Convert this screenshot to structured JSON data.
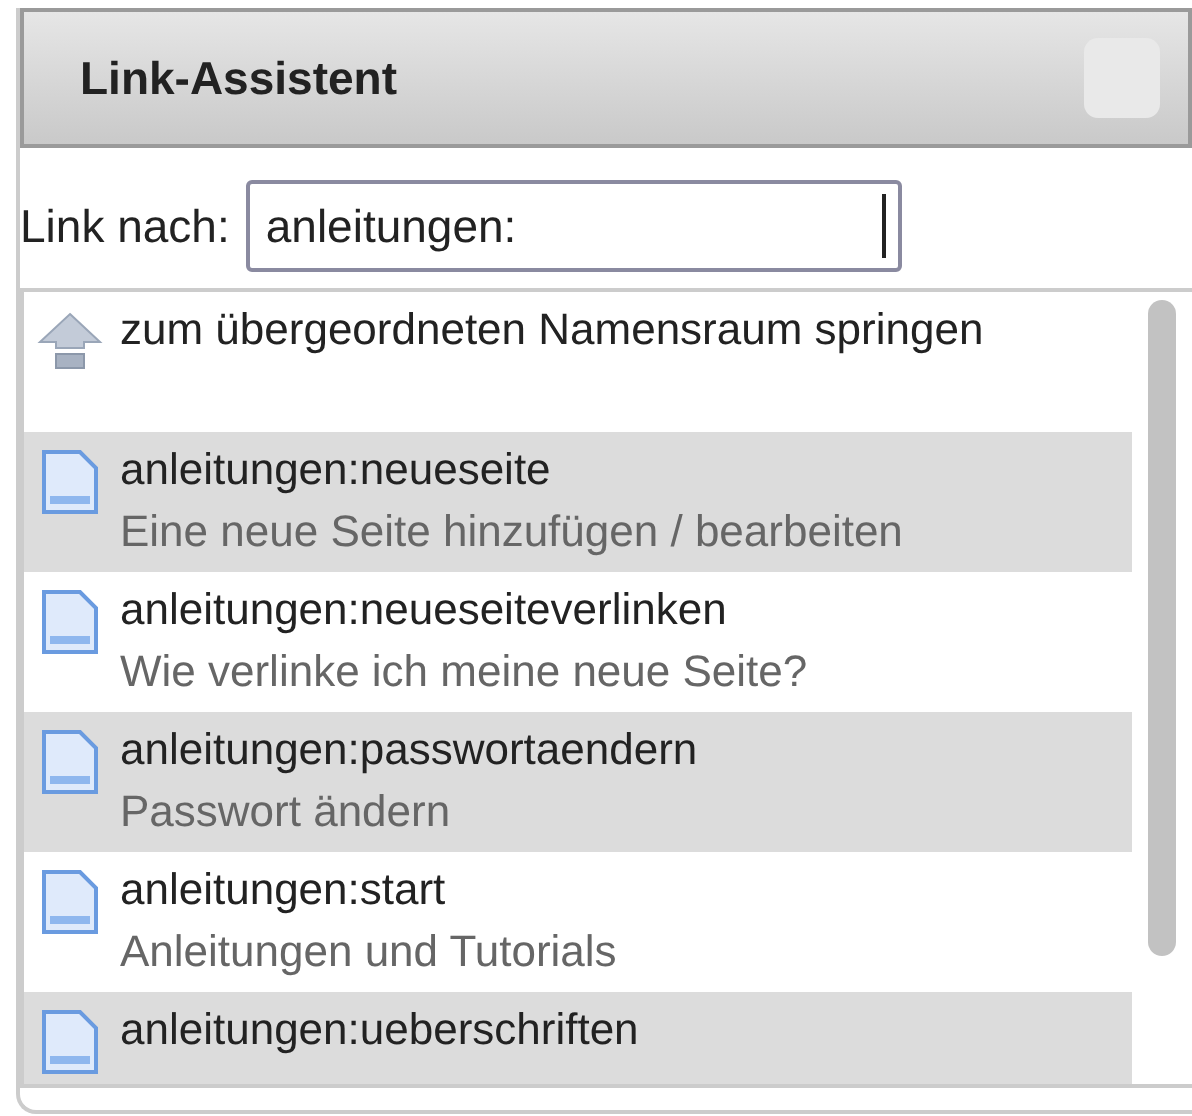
{
  "window": {
    "title": "Link-Assistent"
  },
  "link_field": {
    "label": "Link nach:",
    "value": "anleitungen:"
  },
  "results": [
    {
      "kind": "up",
      "title": "zum übergeordneten Namensraum springen"
    },
    {
      "kind": "page",
      "title": "anleitungen:neueseite",
      "description": "Eine neue Seite hinzufügen / bearbeiten"
    },
    {
      "kind": "page",
      "title": "anleitungen:neueseiteverlinken",
      "description": "Wie verlinke ich meine neue Seite?"
    },
    {
      "kind": "page",
      "title": "anleitungen:passwortaendern",
      "description": "Passwort ändern"
    },
    {
      "kind": "page",
      "title": "anleitungen:start",
      "description": "Anleitungen und Tutorials"
    },
    {
      "kind": "page",
      "title": "anleitungen:ueberschriften"
    }
  ]
}
